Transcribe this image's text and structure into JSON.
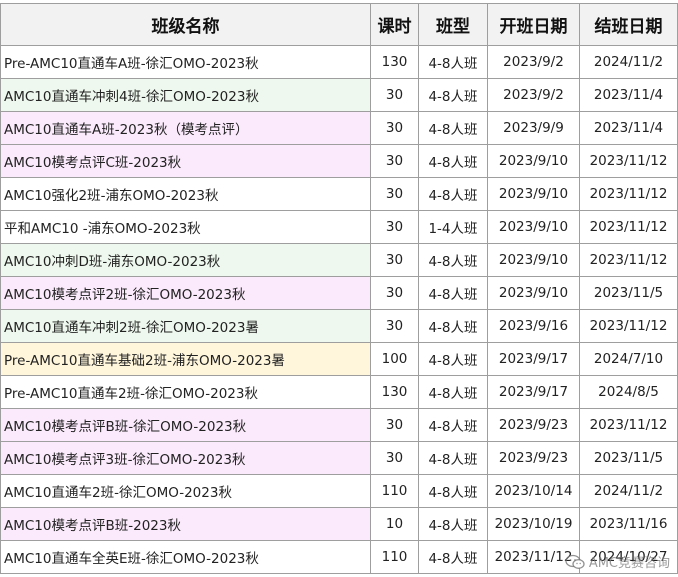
{
  "table": {
    "headers": [
      "班级名称",
      "课时",
      "班型",
      "开班日期",
      "结班日期"
    ],
    "rows": [
      {
        "name": "Pre-AMC10直通车A班-徐汇OMO-2023秋",
        "hours": "130",
        "type": "4-8人班",
        "start": "2023/9/2",
        "end": "2024/11/2",
        "bg": "white"
      },
      {
        "name": "AMC10直通车冲刺4班-徐汇OMO-2023秋",
        "hours": "30",
        "type": "4-8人班",
        "start": "2023/9/2",
        "end": "2023/11/4",
        "bg": "green"
      },
      {
        "name": "AMC10直通车A班-2023秋（模考点评）",
        "hours": "30",
        "type": "4-8人班",
        "start": "2023/9/9",
        "end": "2023/11/4",
        "bg": "purple"
      },
      {
        "name": "AMC10模考点评C班-2023秋",
        "hours": "30",
        "type": "4-8人班",
        "start": "2023/9/10",
        "end": "2023/11/12",
        "bg": "purple"
      },
      {
        "name": "AMC10强化2班-浦东OMO-2023秋",
        "hours": "30",
        "type": "4-8人班",
        "start": "2023/9/10",
        "end": "2023/11/12",
        "bg": "white"
      },
      {
        "name": "平和AMC10 -浦东OMO-2023秋",
        "hours": "30",
        "type": "1-4人班",
        "start": "2023/9/10",
        "end": "2023/11/12",
        "bg": "white"
      },
      {
        "name": "AMC10冲刺D班-浦东OMO-2023秋",
        "hours": "30",
        "type": "4-8人班",
        "start": "2023/9/10",
        "end": "2023/11/12",
        "bg": "green"
      },
      {
        "name": "AMC10模考点评2班-徐汇OMO-2023秋",
        "hours": "30",
        "type": "4-8人班",
        "start": "2023/9/10",
        "end": "2023/11/5",
        "bg": "purple"
      },
      {
        "name": "AMC10直通车冲刺2班-徐汇OMO-2023暑",
        "hours": "30",
        "type": "4-8人班",
        "start": "2023/9/16",
        "end": "2023/11/12",
        "bg": "green"
      },
      {
        "name": "Pre-AMC10直通车基础2班-浦东OMO-2023暑",
        "hours": "100",
        "type": "4-8人班",
        "start": "2023/9/17",
        "end": "2024/7/10",
        "bg": "yellow"
      },
      {
        "name": "Pre-AMC10直通车2班-徐汇OMO-2023秋",
        "hours": "130",
        "type": "4-8人班",
        "start": "2023/9/17",
        "end": "2024/8/5",
        "bg": "white"
      },
      {
        "name": "AMC10模考点评B班-徐汇OMO-2023秋",
        "hours": "30",
        "type": "4-8人班",
        "start": "2023/9/23",
        "end": "2023/11/12",
        "bg": "purple"
      },
      {
        "name": "AMC10模考点评3班-徐汇OMO-2023秋",
        "hours": "30",
        "type": "4-8人班",
        "start": "2023/9/23",
        "end": "2023/11/5",
        "bg": "purple"
      },
      {
        "name": "AMC10直通车2班-徐汇OMO-2023秋",
        "hours": "110",
        "type": "4-8人班",
        "start": "2023/10/14",
        "end": "2024/11/2",
        "bg": "white"
      },
      {
        "name": "AMC10模考点评B班-2023秋",
        "hours": "10",
        "type": "4-8人班",
        "start": "2023/10/19",
        "end": "2023/11/16",
        "bg": "purple"
      },
      {
        "name": "AMC10直通车全英E班-徐汇OMO-2023秋",
        "hours": "110",
        "type": "4-8人班",
        "start": "2023/11/12",
        "end": "2024/10/27",
        "bg": "white"
      }
    ]
  },
  "watermark": {
    "text": "AMC竞赛咨询",
    "icon": "wechat-icon"
  },
  "colors": {
    "header_bg": "#f2f2f2",
    "grid": "#9e9e9e",
    "green": "#eef8ee",
    "purple": "#fbeafb",
    "yellow": "#fff6dc"
  }
}
